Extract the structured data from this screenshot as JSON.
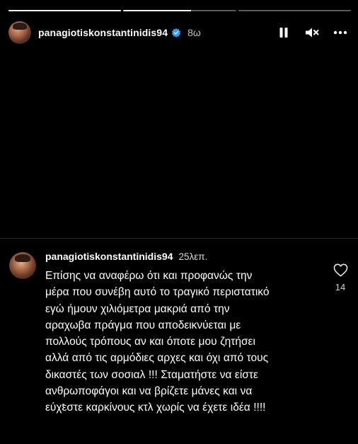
{
  "story": {
    "progress": [
      1.0,
      0.6,
      0.0
    ],
    "username": "panagiotiskonstantinidis94",
    "time": "8ω",
    "verified": true,
    "controls": [
      "pause-icon",
      "mute-icon",
      "more-icon"
    ]
  },
  "post": {
    "username": "panagiotiskonstantinidis94",
    "time": "25λεπ.",
    "text": "Επίσης να αναφέρω ότι και προφανώς την\nμέρα που συνέβη αυτό το τραγικό περιστατικό\nεγώ ήμουν χιλιόμετρα μακριά από την\nαραχωβα πράγμα που αποδεικνύεται με\nπολλούς τρόπους αν και όποτε μου ζητήσει\nαλλά από τις αρμόδιες αρχες και όχι από τους\nδικαστές των σοσιαλ !!! Σταματήστε να είστε\nανθρωποφάγοι και να βρίζετε μάνες και να\nεύχεστε καρκίνους κτλ χωρίς να έχετε ιδέα !!!!",
    "likes": "14"
  },
  "colors": {
    "background": "#000000",
    "text": "#ffffff",
    "verified": "#3897f0"
  }
}
